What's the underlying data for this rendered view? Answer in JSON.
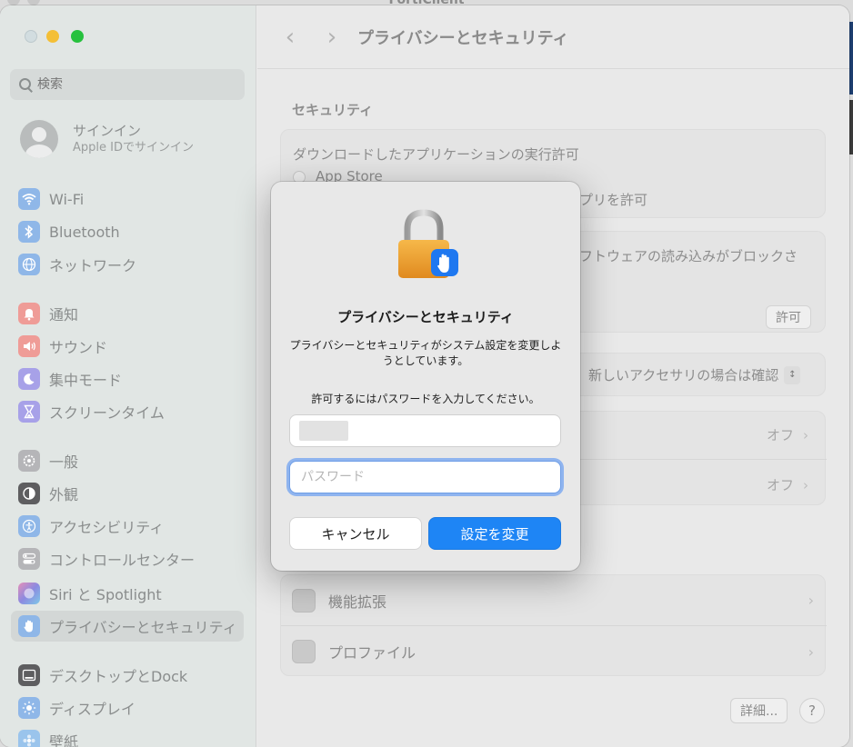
{
  "background": {
    "window_title": "FortiClient"
  },
  "sidebar": {
    "search_placeholder": "検索",
    "account": {
      "title": "サインイン",
      "subtitle": "Apple IDでサインイン"
    },
    "items": [
      {
        "label": "Wi-Fi",
        "icon": "wifi-icon",
        "color": "#3b8bea"
      },
      {
        "label": "Bluetooth",
        "icon": "bluetooth-icon",
        "color": "#3b8bea"
      },
      {
        "label": "ネットワーク",
        "icon": "globe-icon",
        "color": "#3b8bea"
      },
      {
        "label": "通知",
        "icon": "bell-icon",
        "color": "#e8473f"
      },
      {
        "label": "サウンド",
        "icon": "speaker-icon",
        "color": "#e8473f"
      },
      {
        "label": "集中モード",
        "icon": "moon-icon",
        "color": "#5a4fd6"
      },
      {
        "label": "スクリーンタイム",
        "icon": "hourglass-icon",
        "color": "#5a4fd6"
      },
      {
        "label": "一般",
        "icon": "gear-icon",
        "color": "#8e8e93"
      },
      {
        "label": "外観",
        "icon": "appearance-icon",
        "color": "#1c1c1e"
      },
      {
        "label": "アクセシビリティ",
        "icon": "accessibility-icon",
        "color": "#1f7cf0"
      },
      {
        "label": "コントロールセンター",
        "icon": "toggles-icon",
        "color": "#8e8e93"
      },
      {
        "label": "Siri と Spotlight",
        "icon": "siri-icon",
        "color": "#7b56d9"
      },
      {
        "label": "プライバシーとセキュリティ",
        "icon": "hand-icon",
        "color": "#3b8bea",
        "active": true
      },
      {
        "label": "デスクトップとDock",
        "icon": "dock-icon",
        "color": "#1c1c1e"
      },
      {
        "label": "ディスプレイ",
        "icon": "sun-icon",
        "color": "#3b8bea"
      },
      {
        "label": "壁紙",
        "icon": "wallpaper-icon",
        "color": "#3b8bea"
      }
    ]
  },
  "main": {
    "title": "プライバシーとセキュリティ",
    "section_title": "セキュリティ",
    "download_card": {
      "heading": "ダウンロードしたアプリケーションの実行許可",
      "option_app_store": "App Store",
      "option_partial": "プリを許可"
    },
    "blocked_card": {
      "text": "フトウェアの読み込みがブロックさ",
      "allow_button": "許可"
    },
    "accessory_select": "新しいアクセサリの場合は確認",
    "row1_value": "オフ",
    "row2_value": "オフ",
    "list": [
      {
        "label": "機能拡張",
        "icon": "extension-icon"
      },
      {
        "label": "プロファイル",
        "icon": "profile-icon"
      }
    ],
    "detail_button": "詳細...",
    "help_button": "?"
  },
  "dialog": {
    "title": "プライバシーとセキュリティ",
    "message": "プライバシーとセキュリティがシステム設定を変更しようとしています。",
    "prompt": "許可するにはパスワードを入力してください。",
    "username_value": "",
    "password_placeholder": "パスワード",
    "cancel_label": "キャンセル",
    "confirm_label": "設定を変更",
    "accent": "#1e85f5"
  }
}
